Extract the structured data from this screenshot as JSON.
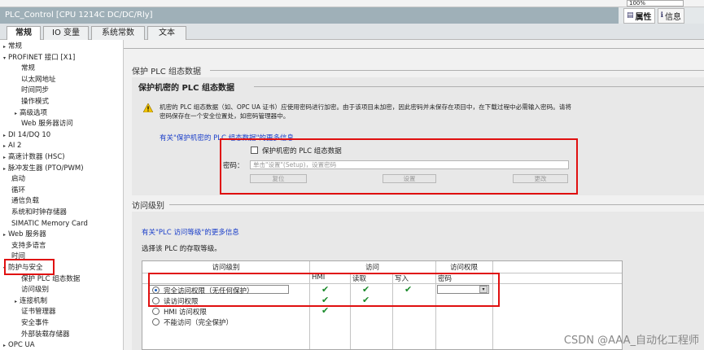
{
  "top": {
    "zoom": "100%"
  },
  "window": {
    "title": "PLC_Control [CPU 1214C DC/DC/Rly]"
  },
  "right_tabs": [
    {
      "label": "属性",
      "icon": "properties-icon"
    },
    {
      "label": "信息",
      "icon": "info-icon"
    }
  ],
  "tabs": [
    "常规",
    "IO 变量",
    "系统常数",
    "文本"
  ],
  "sidebar": {
    "items": [
      {
        "label": "常规",
        "tri": "▸"
      },
      {
        "label": "PROFINET 接口 [X1]",
        "tri": "▾"
      },
      {
        "label": "常规",
        "tri": ""
      },
      {
        "label": "以太网地址",
        "tri": ""
      },
      {
        "label": "时间同步",
        "tri": ""
      },
      {
        "label": "操作模式",
        "tri": ""
      },
      {
        "label": "高级选项",
        "tri": "▸"
      },
      {
        "label": "Web 服务器访问",
        "tri": ""
      },
      {
        "label": "DI 14/DQ 10",
        "tri": "▸"
      },
      {
        "label": "AI 2",
        "tri": "▸"
      },
      {
        "label": "高速计数器 (HSC)",
        "tri": "▸"
      },
      {
        "label": "脉冲发生器 (PTO/PWM)",
        "tri": "▸"
      },
      {
        "label": "启动",
        "tri": ""
      },
      {
        "label": "循环",
        "tri": ""
      },
      {
        "label": "通信负载",
        "tri": ""
      },
      {
        "label": "系统和时钟存储器",
        "tri": ""
      },
      {
        "label": "SIMATIC Memory Card",
        "tri": ""
      },
      {
        "label": "Web 服务器",
        "tri": "▸"
      },
      {
        "label": "支持多语言",
        "tri": ""
      },
      {
        "label": "时间",
        "tri": ""
      },
      {
        "label": "防护与安全",
        "tri": "▾"
      },
      {
        "label": "保护 PLC 组态数据",
        "tri": ""
      },
      {
        "label": "访问级别",
        "tri": ""
      },
      {
        "label": "连接机制",
        "tri": "▸"
      },
      {
        "label": "证书管理器",
        "tri": ""
      },
      {
        "label": "安全事件",
        "tri": ""
      },
      {
        "label": "外部装载存储器",
        "tri": ""
      },
      {
        "label": "OPC UA",
        "tri": "▸"
      }
    ]
  },
  "protect": {
    "section_title": "保护 PLC 组态数据",
    "heading": "保护机密的 PLC 组态数据",
    "warning_line1": "机密的 PLC 组态数据（如、OPC UA 证书）应使用密码进行加密。由于该项目未加密，因此密码并未保存在项目中，在下载过程中必需输入密码。请将",
    "warning_line2": "密码保存在一个安全位置处，如密码管理器中。",
    "link": "有关\"保护机密的 PLC 组态数据\"的更多信息",
    "checkbox_label": "保护机密的 PLC 组态数据",
    "password_label": "密码：",
    "password_placeholder": "单击\"设置\"(Setup)，设置密码",
    "btn_reset": "复位",
    "btn_set": "设置",
    "btn_change": "更改"
  },
  "access": {
    "section_title": "访问级别",
    "link": "有关\"PLC 访问等级\"的更多信息",
    "select_text": "选择该 PLC 的存取等级。",
    "headers": {
      "level": "访问级别",
      "access": "访问",
      "permission": "访问权限"
    },
    "subheaders": [
      "HMI",
      "读取",
      "写入",
      "密码"
    ],
    "rows": [
      {
        "label": "完全访问权限（无任何保护）",
        "selected": true,
        "hmi": true,
        "read": true,
        "write": true
      },
      {
        "label": "读访问权限",
        "selected": false,
        "hmi": true,
        "read": true,
        "write": false
      },
      {
        "label": "HMI 访问权限",
        "selected": false,
        "hmi": true,
        "read": false,
        "write": false
      },
      {
        "label": "不能访问（完全保护）",
        "selected": false,
        "hmi": false,
        "read": false,
        "write": false
      }
    ]
  },
  "watermark": "CSDN @AAA_自动化工程师",
  "colors": {
    "highlight": "#e01010",
    "link": "#1a3ec9",
    "check": "#1a8a2a",
    "titlebar": "#9fb0b8"
  }
}
